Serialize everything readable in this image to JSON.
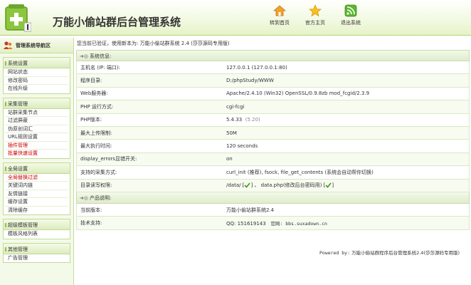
{
  "header": {
    "title": "万能小偷站群后台管理系统",
    "nav": [
      {
        "label": "转到首页",
        "icon": "home-icon"
      },
      {
        "label": "官方主页",
        "icon": "star-icon"
      },
      {
        "label": "退出系统",
        "icon": "rss-exit-icon"
      }
    ]
  },
  "sidebar": {
    "title": "管理系统导航区",
    "groups": [
      {
        "title": "系统设置",
        "items": [
          {
            "label": "网站状态"
          },
          {
            "label": "修改密码"
          },
          {
            "label": "在线升级"
          }
        ]
      },
      {
        "title": "采集管理",
        "items": [
          {
            "label": "站群采集节点"
          },
          {
            "label": "过滤屏蔽"
          },
          {
            "label": "伪原创词汇"
          },
          {
            "label": "URL规则设置"
          },
          {
            "label": "插件管理"
          },
          {
            "label": "批量快速设置"
          }
        ]
      },
      {
        "title": "全局设置",
        "items": [
          {
            "label": "全局替换过滤"
          },
          {
            "label": "关键词内链"
          },
          {
            "label": "友情链接"
          },
          {
            "label": "缓存设置"
          },
          {
            "label": "清除缓存"
          }
        ]
      },
      {
        "title": "超级模板管理",
        "items": [
          {
            "label": "模板风格列表"
          }
        ]
      },
      {
        "title": "其他管理",
        "items": [
          {
            "label": "广告管理"
          }
        ]
      }
    ]
  },
  "main": {
    "welcome": "您当前已验证，使用新本为: 万能小偷站群系统 2.4 (莎莎源码专用版)",
    "sysinfo": {
      "title": "系统信息:",
      "rows": [
        {
          "k": "主机名 (IP: 端口):",
          "v": "127.0.0.1  (127.0.0.1:80)"
        },
        {
          "k": "程序目录:",
          "v": "D:/phpStudy/WWW"
        },
        {
          "k": "Web服务器:",
          "v": "Apache/2.4.10 (Win32) OpenSSL/0.9.8zb mod_fcgid/2.3.9"
        },
        {
          "k": "PHP 运行方式:",
          "v": "cgi-fcgi"
        },
        {
          "k": "PHP版本:",
          "v": "5.4.33",
          "v2": "(5.20)"
        },
        {
          "k": "最大上传限制:",
          "v": "50M"
        },
        {
          "k": "最大执行时间:",
          "v": "120 seconds"
        },
        {
          "k": "display_errors显错开关:",
          "v": "on"
        }
      ],
      "collect_label": "支持的采集方式:",
      "collect_value": "curl_init (推荐),  fsock,  file_get_contents (系统会自动帮你切换)",
      "perm_label": "目录读写权限:",
      "perm_a": "/data/ [",
      "perm_b": "] 、 data.php(修改后台密码用) [",
      "perm_c": "]"
    },
    "product": {
      "title": "产品说明:",
      "version_label": "当前版本:",
      "version_value": "万能小偷站群系统2.4",
      "support_label": "技术支持:",
      "support_qq": "QQ: 151619143",
      "support_site": "官网: bbs.suxadown.cn"
    },
    "footer_powered": "Powered by:",
    "footer_text": "万能小偷站群程序后台管理系统2.4(莎莎源码专用版)"
  }
}
